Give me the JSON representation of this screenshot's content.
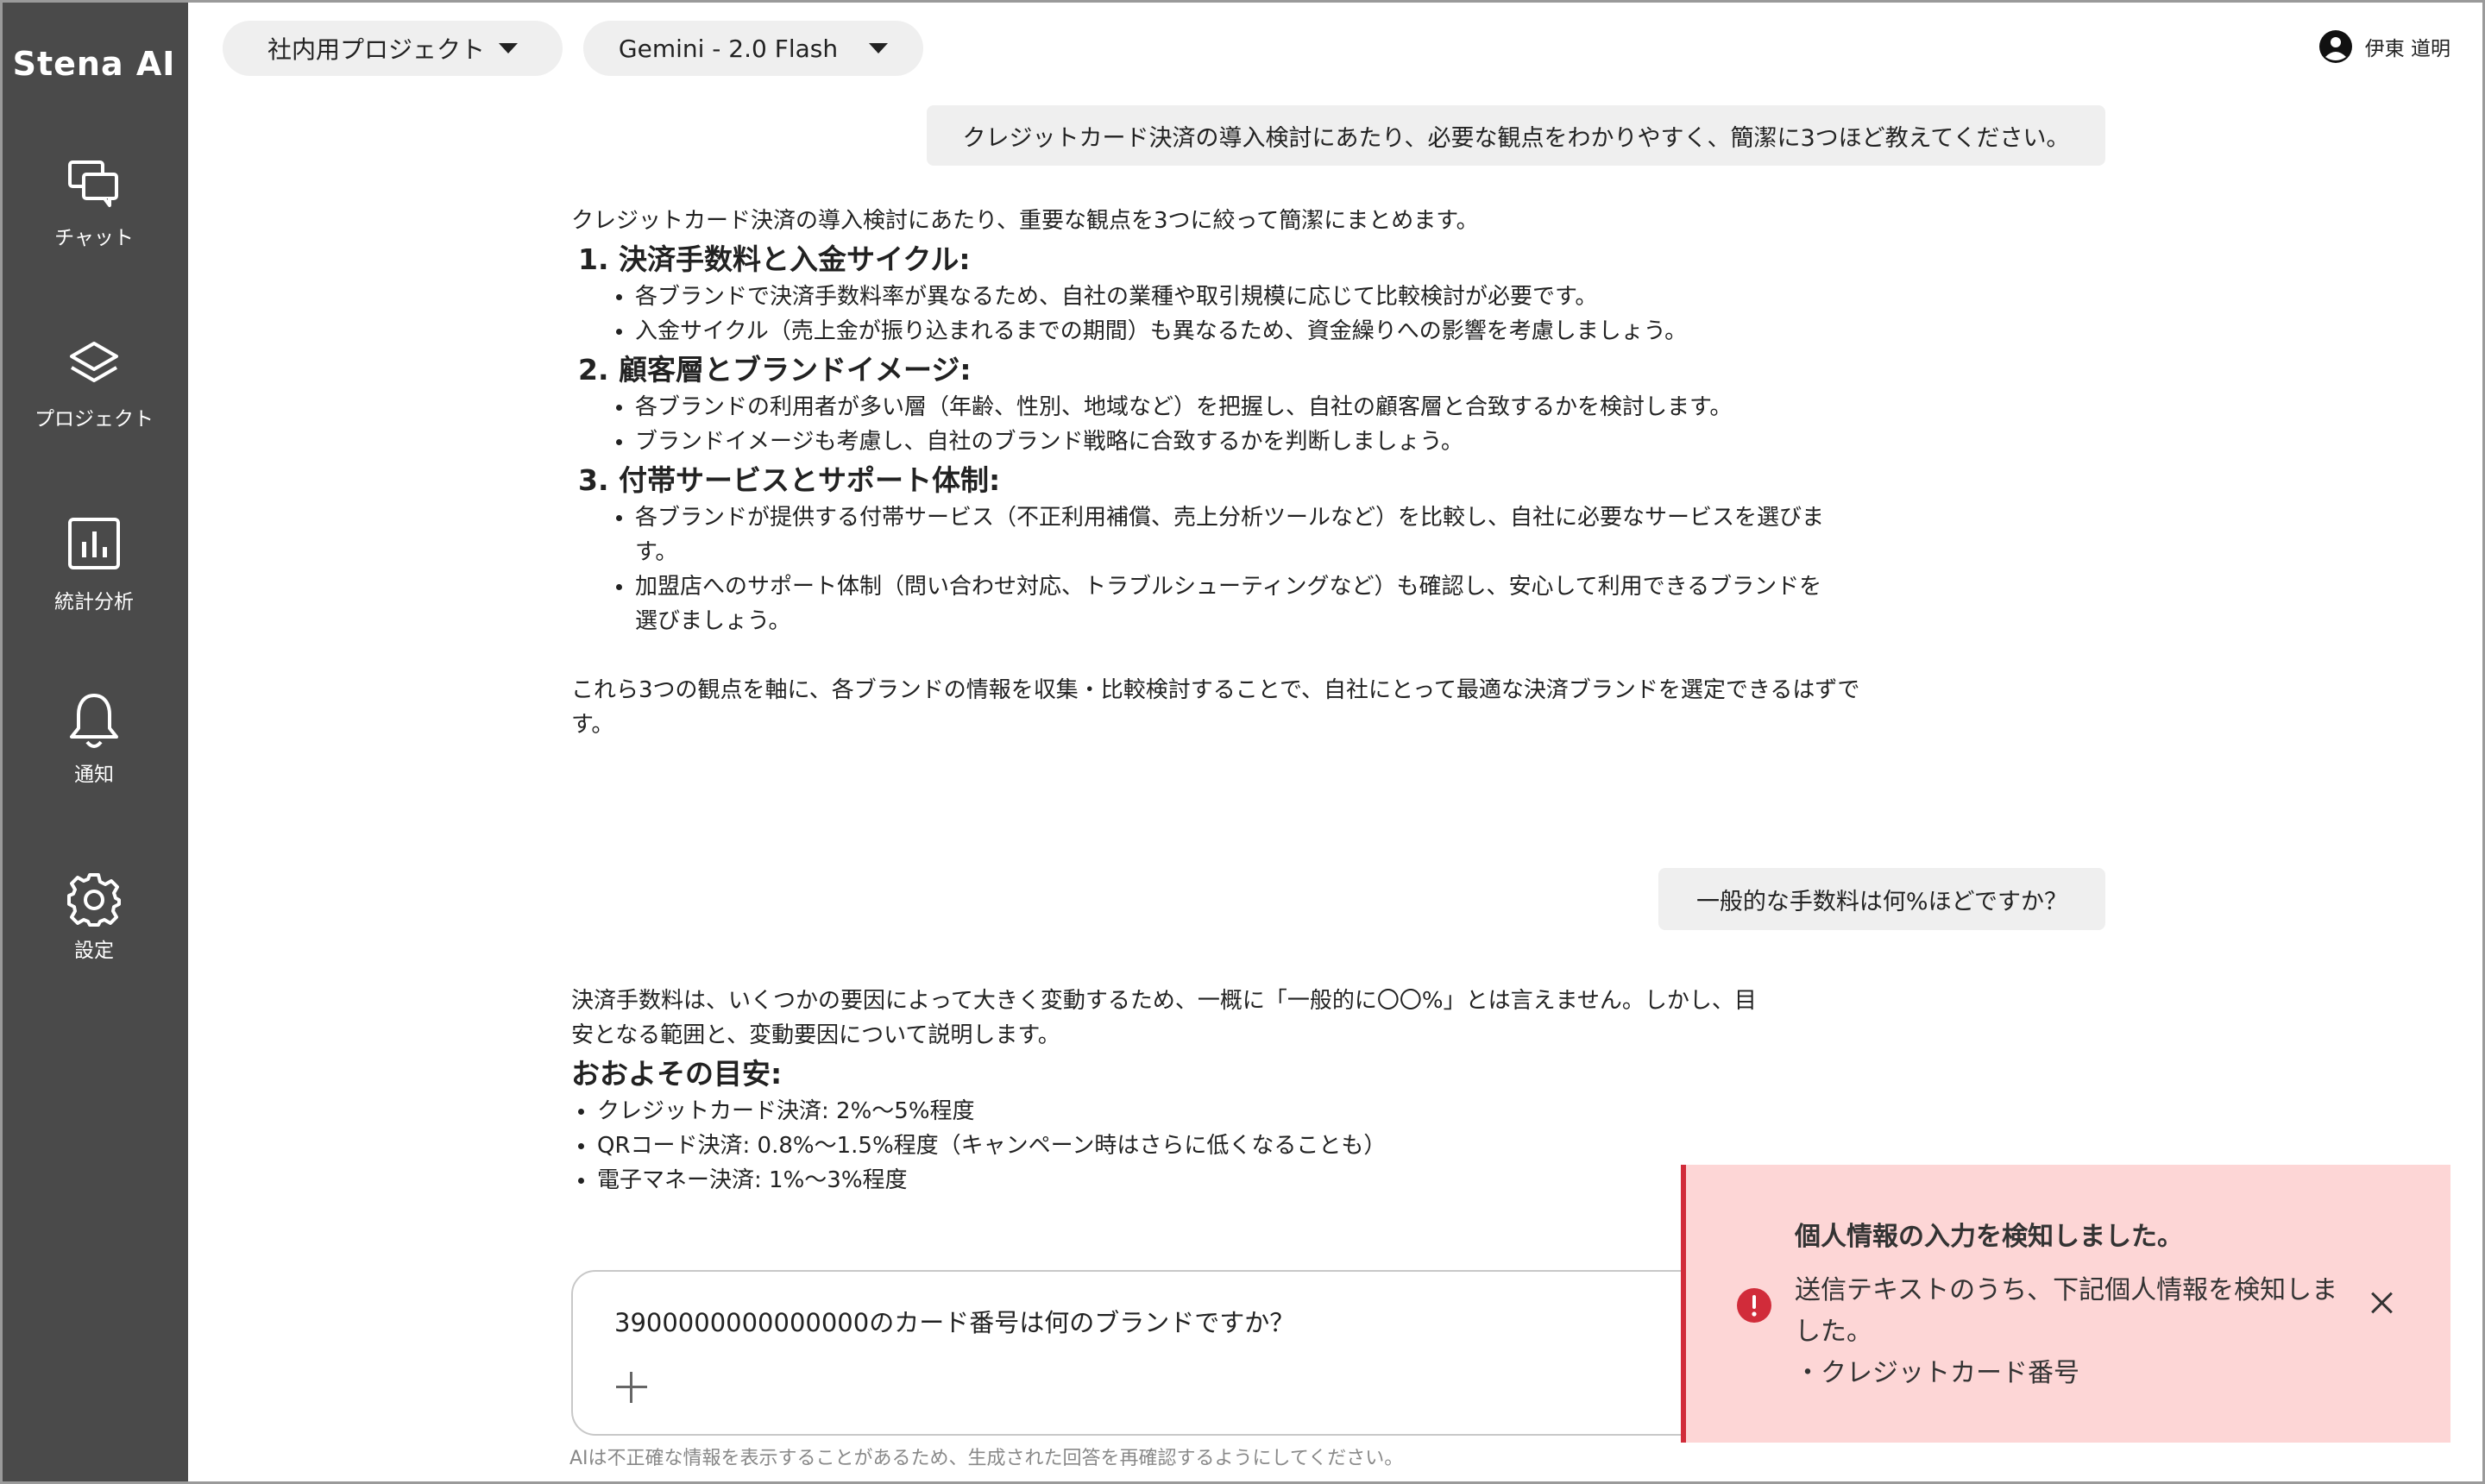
{
  "app": {
    "brand": "Stena AI"
  },
  "sidebar": {
    "items": [
      {
        "label": "チャット",
        "icon": "chat-icon"
      },
      {
        "label": "プロジェクト",
        "icon": "layers-icon"
      },
      {
        "label": "統計分析",
        "icon": "chart-icon"
      },
      {
        "label": "通知",
        "icon": "bell-icon"
      },
      {
        "label": "設定",
        "icon": "gear-icon"
      }
    ]
  },
  "header": {
    "project_selector": "社内用プロジェクト",
    "model_selector": "Gemini - 2.0 Flash",
    "user_name": "伊東 道明"
  },
  "chat": {
    "q1": "クレジットカード決済の導入検討にあたり、必要な観点をわかりやすく、簡潔に3つほど教えてください。",
    "a1": {
      "intro": "クレジットカード決済の導入検討にあたり、重要な観点を3つに絞って簡潔にまとめます。",
      "sections": [
        {
          "heading": "1. 決済手数料と入金サイクル:",
          "bullets": [
            "各ブランドで決済手数料率が異なるため、自社の業種や取引規模に応じて比較検討が必要です。",
            "入金サイクル（売上金が振り込まれるまでの期間）も異なるため、資金繰りへの影響を考慮しましょう。"
          ]
        },
        {
          "heading": "2. 顧客層とブランドイメージ:",
          "bullets": [
            "各ブランドの利用者が多い層（年齢、性別、地域など）を把握し、自社の顧客層と合致するかを検討します。",
            "ブランドイメージも考慮し、自社のブランド戦略に合致するかを判断しましょう。"
          ]
        },
        {
          "heading": "3. 付帯サービスとサポート体制:",
          "bullets": [
            "各ブランドが提供する付帯サービス（不正利用補償、売上分析ツールなど）を比較し、自社に必要なサービスを選びます。",
            "加盟店へのサポート体制（問い合わせ対応、トラブルシューティングなど）も確認し、安心して利用できるブランドを選びましょう。"
          ]
        }
      ],
      "outro": "これら3つの観点を軸に、各ブランドの情報を収集・比較検討することで、自社にとって最適な決済ブランドを選定できるはずです。"
    },
    "q2": "一般的な手数料は何%ほどですか？",
    "a2": {
      "intro": "決済手数料は、いくつかの要因によって大きく変動するため、一概に「一般的に〇〇%」とは言えません。しかし、目安となる範囲と、変動要因について説明します。",
      "heading": "おおよその目安:",
      "bullets": [
        "クレジットカード決済: 2%〜5%程度",
        "QRコード決済: 0.8%〜1.5%程度（キャンペーン時はさらに低くなることも）",
        "電子マネー決済: 1%〜3%程度"
      ]
    }
  },
  "composer": {
    "value": "3900000000000000のカード番号は何のブランドですか？",
    "disclaimer": "AIは不正確な情報を表示することがあるため、生成された回答を再確認するようにしてください。"
  },
  "toast": {
    "title": "個人情報の入力を検知しました。",
    "body": "送信テキストのうち、下記個人情報を検知しました。",
    "item": "・クレジットカード番号",
    "accent_color": "#d12c3a",
    "background_color": "#fdd6d6"
  }
}
